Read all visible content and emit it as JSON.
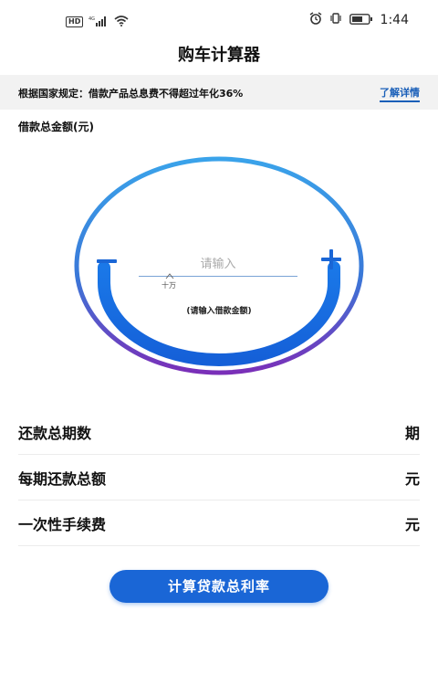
{
  "status_bar": {
    "network": "4G",
    "time": "1:44",
    "hd_badge": "HD"
  },
  "app": {
    "title": "购车计算器"
  },
  "notice": {
    "text": "根据国家规定：借款产品总息费不得超过年化36%",
    "link": "了解详情"
  },
  "loan_amount": {
    "label": "借款总金额(元)",
    "placeholder": "请输入",
    "unit": "十万",
    "hint": "(请输入借款金额)"
  },
  "rows": [
    {
      "label": "还款总期数",
      "unit": "期"
    },
    {
      "label": "每期还款总额",
      "unit": "元"
    },
    {
      "label": "一次性手续费",
      "unit": "元"
    }
  ],
  "calculate_button": "计算贷款总利率",
  "colors": {
    "accent": "#1a66d6",
    "ring_top": "#39a0e8",
    "ring_bottom": "#7a2fb8",
    "link": "#1a5fb8"
  }
}
